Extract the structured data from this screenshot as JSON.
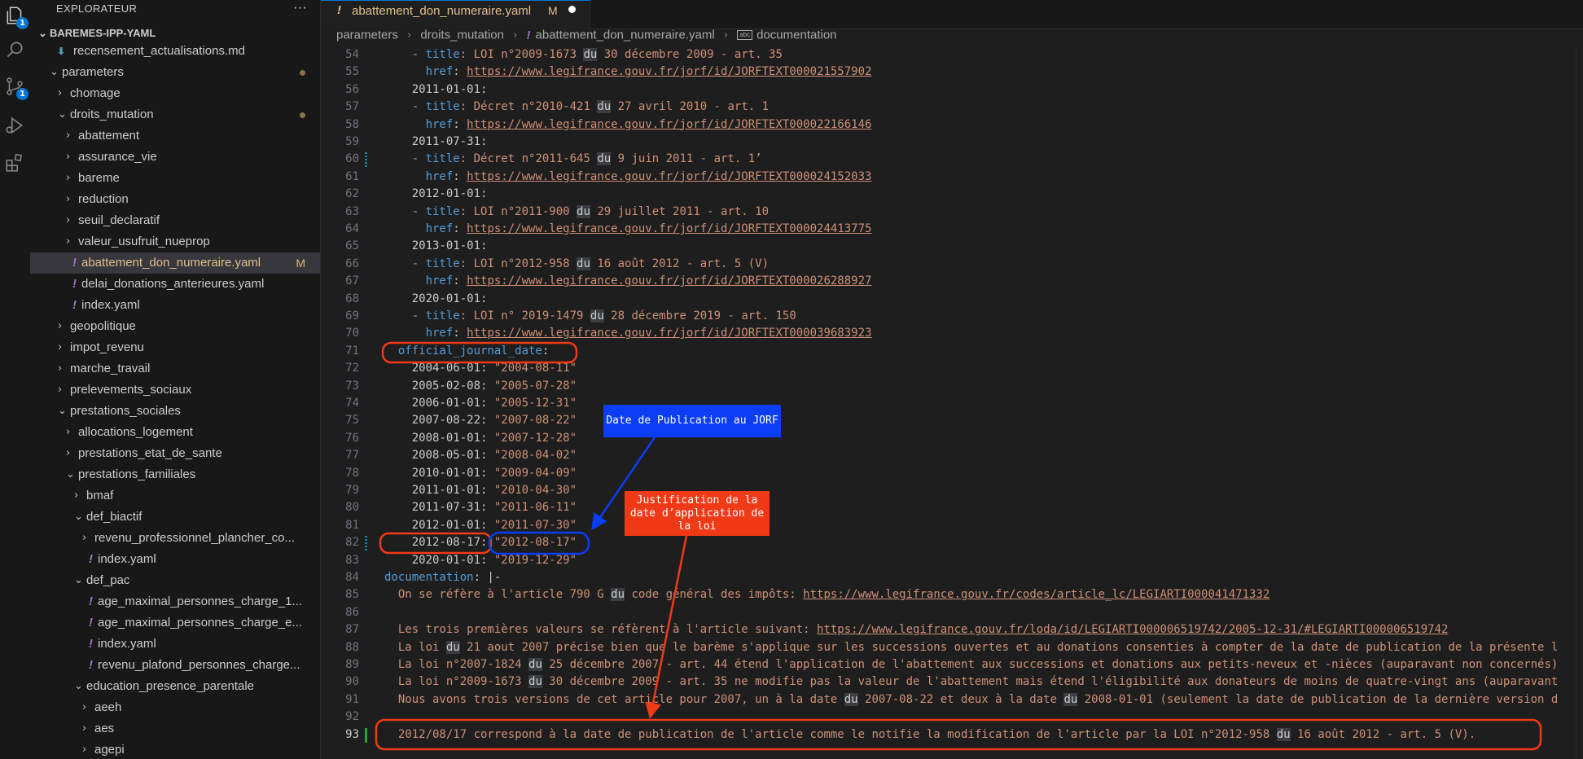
{
  "explorer": {
    "title": "EXPLORATEUR",
    "more": "···",
    "workspace": "BAREMES-IPP-YAML",
    "badges": {
      "explorer": "1",
      "scm": "1"
    },
    "tree": [
      {
        "label": "recensement_actualisations.md",
        "type": "md",
        "depth": 2
      },
      {
        "label": "parameters",
        "type": "folder",
        "depth": 1,
        "open": true,
        "dot": true
      },
      {
        "label": "chomage",
        "type": "folder",
        "depth": 2,
        "open": false
      },
      {
        "label": "droits_mutation",
        "type": "folder",
        "depth": 2,
        "open": true,
        "dot": true
      },
      {
        "label": "abattement",
        "type": "folder",
        "depth": 3,
        "open": false
      },
      {
        "label": "assurance_vie",
        "type": "folder",
        "depth": 3,
        "open": false
      },
      {
        "label": "bareme",
        "type": "folder",
        "depth": 3,
        "open": false
      },
      {
        "label": "reduction",
        "type": "folder",
        "depth": 3,
        "open": false
      },
      {
        "label": "seuil_declaratif",
        "type": "folder",
        "depth": 3,
        "open": false
      },
      {
        "label": "valeur_usufruit_nueprop",
        "type": "folder",
        "depth": 3,
        "open": false
      },
      {
        "label": "abattement_don_numeraire.yaml",
        "type": "yaml",
        "depth": 3,
        "selected": true,
        "modified": "M"
      },
      {
        "label": "delai_donations_anterieures.yaml",
        "type": "yaml",
        "depth": 3
      },
      {
        "label": "index.yaml",
        "type": "yaml",
        "depth": 3
      },
      {
        "label": "geopolitique",
        "type": "folder",
        "depth": 2,
        "open": false
      },
      {
        "label": "impot_revenu",
        "type": "folder",
        "depth": 2,
        "open": false
      },
      {
        "label": "marche_travail",
        "type": "folder",
        "depth": 2,
        "open": false
      },
      {
        "label": "prelevements_sociaux",
        "type": "folder",
        "depth": 2,
        "open": false
      },
      {
        "label": "prestations_sociales",
        "type": "folder",
        "depth": 2,
        "open": true
      },
      {
        "label": "allocations_logement",
        "type": "folder",
        "depth": 3,
        "open": false
      },
      {
        "label": "prestations_etat_de_sante",
        "type": "folder",
        "depth": 3,
        "open": false
      },
      {
        "label": "prestations_familiales",
        "type": "folder",
        "depth": 3,
        "open": true
      },
      {
        "label": "bmaf",
        "type": "folder",
        "depth": 4,
        "open": false
      },
      {
        "label": "def_biactif",
        "type": "folder",
        "depth": 4,
        "open": true
      },
      {
        "label": "revenu_professionnel_plancher_co...",
        "type": "folder",
        "depth": 5,
        "open": false
      },
      {
        "label": "index.yaml",
        "type": "yaml",
        "depth": 5
      },
      {
        "label": "def_pac",
        "type": "folder",
        "depth": 4,
        "open": true
      },
      {
        "label": "age_maximal_personnes_charge_1...",
        "type": "yaml",
        "depth": 5
      },
      {
        "label": "age_maximal_personnes_charge_e...",
        "type": "yaml",
        "depth": 5
      },
      {
        "label": "index.yaml",
        "type": "yaml",
        "depth": 5
      },
      {
        "label": "revenu_plafond_personnes_charge...",
        "type": "yaml",
        "depth": 5
      },
      {
        "label": "education_presence_parentale",
        "type": "folder",
        "depth": 4,
        "open": true
      },
      {
        "label": "aeeh",
        "type": "folder",
        "depth": 5,
        "open": false
      },
      {
        "label": "aes",
        "type": "folder",
        "depth": 5,
        "open": false
      },
      {
        "label": "agepi",
        "type": "folder",
        "depth": 5,
        "open": false
      }
    ]
  },
  "tab": {
    "fileicon": "!",
    "name": "abattement_don_numeraire.yaml",
    "status": "M"
  },
  "breadcrumb": {
    "parts": [
      "parameters",
      "droits_mutation",
      "abattement_don_numeraire.yaml",
      "documentation"
    ]
  },
  "editor": {
    "lines": [
      {
        "n": 54,
        "t": [
          [
            "    ",
            "p"
          ],
          [
            "- ",
            "dash"
          ],
          [
            "title",
            "k"
          ],
          [
            ": LOI n°2009-1673 ",
            "s"
          ],
          [
            "du",
            "hl"
          ],
          [
            " 30 décembre 2009 - art. 35",
            "s"
          ]
        ]
      },
      {
        "n": 55,
        "t": [
          [
            "      ",
            "p"
          ],
          [
            "href",
            "k"
          ],
          [
            ": ",
            "p"
          ],
          [
            "https://www.legifrance.gouv.fr/jorf/id/JORFTEXT000021557902",
            "u"
          ]
        ]
      },
      {
        "n": 56,
        "t": [
          [
            "    2011-01-01:",
            "p"
          ]
        ]
      },
      {
        "n": 57,
        "t": [
          [
            "    ",
            "p"
          ],
          [
            "- ",
            "dash"
          ],
          [
            "title",
            "k"
          ],
          [
            ": Décret n°2010-421 ",
            "s"
          ],
          [
            "du",
            "hl"
          ],
          [
            " 27 avril 2010 - art. 1",
            "s"
          ]
        ]
      },
      {
        "n": 58,
        "t": [
          [
            "      ",
            "p"
          ],
          [
            "href",
            "k"
          ],
          [
            ": ",
            "p"
          ],
          [
            "https://www.legifrance.gouv.fr/jorf/id/JORFTEXT000022166146",
            "u"
          ]
        ]
      },
      {
        "n": 59,
        "t": [
          [
            "    2011-07-31:",
            "p"
          ]
        ]
      },
      {
        "n": 60,
        "t": [
          [
            "    ",
            "p"
          ],
          [
            "- ",
            "dash"
          ],
          [
            "title",
            "k"
          ],
          [
            ": Décret n°2011-645 ",
            "s"
          ],
          [
            "du",
            "hl"
          ],
          [
            " 9 juin 2011 - art. 1’",
            "s"
          ]
        ]
      },
      {
        "n": 61,
        "t": [
          [
            "      ",
            "p"
          ],
          [
            "href",
            "k"
          ],
          [
            ": ",
            "p"
          ],
          [
            "https://www.legifrance.gouv.fr/jorf/id/JORFTEXT000024152033",
            "u"
          ]
        ]
      },
      {
        "n": 62,
        "t": [
          [
            "    2012-01-01:",
            "p"
          ]
        ]
      },
      {
        "n": 63,
        "t": [
          [
            "    ",
            "p"
          ],
          [
            "- ",
            "dash"
          ],
          [
            "title",
            "k"
          ],
          [
            ": LOI n°2011-900 ",
            "s"
          ],
          [
            "du",
            "hl"
          ],
          [
            " 29 juillet 2011 - art. 10",
            "s"
          ]
        ]
      },
      {
        "n": 64,
        "t": [
          [
            "      ",
            "p"
          ],
          [
            "href",
            "k"
          ],
          [
            ": ",
            "p"
          ],
          [
            "https://www.legifrance.gouv.fr/jorf/id/JORFTEXT000024413775",
            "u"
          ]
        ]
      },
      {
        "n": 65,
        "t": [
          [
            "    2013-01-01:",
            "p"
          ]
        ]
      },
      {
        "n": 66,
        "t": [
          [
            "    ",
            "p"
          ],
          [
            "- ",
            "dash"
          ],
          [
            "title",
            "k"
          ],
          [
            ": LOI n°2012-958 ",
            "s"
          ],
          [
            "du",
            "hl"
          ],
          [
            " 16 août 2012 - art. 5 (V)",
            "s"
          ]
        ]
      },
      {
        "n": 67,
        "t": [
          [
            "      ",
            "p"
          ],
          [
            "href",
            "k"
          ],
          [
            ": ",
            "p"
          ],
          [
            "https://www.legifrance.gouv.fr/jorf/id/JORFTEXT000026288927",
            "u"
          ]
        ]
      },
      {
        "n": 68,
        "t": [
          [
            "    2020-01-01:",
            "p"
          ]
        ]
      },
      {
        "n": 69,
        "t": [
          [
            "    ",
            "p"
          ],
          [
            "- ",
            "dash"
          ],
          [
            "title",
            "k"
          ],
          [
            ": LOI n° 2019-1479 ",
            "s"
          ],
          [
            "du",
            "hl"
          ],
          [
            " 28 décembre 2019 - art. 150",
            "s"
          ]
        ]
      },
      {
        "n": 70,
        "t": [
          [
            "      ",
            "p"
          ],
          [
            "href",
            "k"
          ],
          [
            ": ",
            "p"
          ],
          [
            "https://www.legifrance.gouv.fr/jorf/id/JORFTEXT000039683923",
            "u"
          ]
        ]
      },
      {
        "n": 71,
        "t": [
          [
            "  ",
            "p"
          ],
          [
            "official_journal_date",
            "k"
          ],
          [
            ":",
            "p"
          ]
        ]
      },
      {
        "n": 72,
        "t": [
          [
            "    2004-06-01: ",
            "p"
          ],
          [
            "\"2004-08-11\"",
            "s"
          ]
        ]
      },
      {
        "n": 73,
        "t": [
          [
            "    2005-02-08: ",
            "p"
          ],
          [
            "\"2005-07-28\"",
            "s"
          ]
        ]
      },
      {
        "n": 74,
        "t": [
          [
            "    2006-01-01: ",
            "p"
          ],
          [
            "\"2005-12-31\"",
            "s"
          ]
        ]
      },
      {
        "n": 75,
        "t": [
          [
            "    2007-08-22: ",
            "p"
          ],
          [
            "\"2007-08-22\"",
            "s"
          ]
        ]
      },
      {
        "n": 76,
        "t": [
          [
            "    2008-01-01: ",
            "p"
          ],
          [
            "\"2007-12-28\"",
            "s"
          ]
        ]
      },
      {
        "n": 77,
        "t": [
          [
            "    2008-05-01: ",
            "p"
          ],
          [
            "\"2008-04-02\"",
            "s"
          ]
        ]
      },
      {
        "n": 78,
        "t": [
          [
            "    2010-01-01: ",
            "p"
          ],
          [
            "\"2009-04-09\"",
            "s"
          ]
        ]
      },
      {
        "n": 79,
        "t": [
          [
            "    2011-01-01: ",
            "p"
          ],
          [
            "\"2010-04-30\"",
            "s"
          ]
        ]
      },
      {
        "n": 80,
        "t": [
          [
            "    2011-07-31: ",
            "p"
          ],
          [
            "\"2011-06-11\"",
            "s"
          ]
        ]
      },
      {
        "n": 81,
        "t": [
          [
            "    2012-01-01: ",
            "p"
          ],
          [
            "\"2011-07-30\"",
            "s"
          ]
        ]
      },
      {
        "n": 82,
        "t": [
          [
            "    2012-08-17: ",
            "p"
          ],
          [
            "\"2012-08-17\"",
            "s"
          ]
        ]
      },
      {
        "n": 83,
        "t": [
          [
            "    2020-01-01: ",
            "p"
          ],
          [
            "\"2019-12-29\"",
            "s"
          ]
        ]
      },
      {
        "n": 84,
        "t": [
          [
            "documentation",
            "k"
          ],
          [
            ": |-",
            "p"
          ]
        ]
      },
      {
        "n": 85,
        "t": [
          [
            "  On se réfère à l'article 790 G ",
            "s"
          ],
          [
            "du",
            "hl"
          ],
          [
            " code général des impôts: ",
            "s"
          ],
          [
            "https://www.legifrance.gouv.fr/codes/article_lc/LEGIARTI000041471332",
            "u"
          ]
        ]
      },
      {
        "n": 86,
        "t": [
          [
            "",
            "p"
          ]
        ]
      },
      {
        "n": 87,
        "t": [
          [
            "  Les trois premières valeurs se réfèrent à l'article suivant: ",
            "s"
          ],
          [
            "https://www.legifrance.gouv.fr/loda/id/LEGIARTI000006519742/2005-12-31/#LEGIARTI000006519742",
            "u"
          ]
        ]
      },
      {
        "n": 88,
        "t": [
          [
            "  La loi ",
            "s"
          ],
          [
            "du",
            "hl"
          ],
          [
            " 21 aout 2007 précise bien que le barème s'applique sur les successions ouvertes et au donations consenties à compter de la date de publication de la présente l",
            "s"
          ]
        ]
      },
      {
        "n": 89,
        "t": [
          [
            "  La loi n°2007-1824 ",
            "s"
          ],
          [
            "du",
            "hl"
          ],
          [
            " 25 décembre 2007 - art. 44 étend l'application de l'abattement aux successions et donations aux petits-neveux et -nièces (auparavant non concernés)",
            "s"
          ]
        ]
      },
      {
        "n": 90,
        "t": [
          [
            "  La loi n°2009-1673 ",
            "s"
          ],
          [
            "du",
            "hl"
          ],
          [
            " 30 décembre 2009 - art. 35 ne modifie pas la valeur de l'abattement mais étend l'éligibilité aux donateurs de moins de quatre-vingt ans (auparavant",
            "s"
          ]
        ]
      },
      {
        "n": 91,
        "t": [
          [
            "  Nous avons trois versions de cet article pour 2007, un à la date ",
            "s"
          ],
          [
            "du",
            "hl"
          ],
          [
            " 2007-08-22 et deux à la date ",
            "s"
          ],
          [
            "du",
            "hl"
          ],
          [
            " 2008-01-01 (seulement la date de publication de la dernière version d",
            "s"
          ]
        ]
      },
      {
        "n": 92,
        "t": [
          [
            "",
            "p"
          ]
        ]
      },
      {
        "n": 93,
        "t": [
          [
            "  2012/08/17 correspond à la date de publication de l'article comme le notifie la modification de l'article par la LOI n°2012-958 ",
            "s"
          ],
          [
            "du",
            "hl"
          ],
          [
            " 16 août 2012 - art. 5 (V).",
            "s"
          ]
        ]
      }
    ]
  },
  "annotations": {
    "blue_label": "Date de Publication au JORF",
    "red_label": "Justification de la date d’application de la loi",
    "blue_color": "#0b3df5",
    "red_color": "#f03a17"
  },
  "colors": {
    "accent": "#0078d4",
    "keyword": "#569cd6",
    "string": "#ce9178",
    "modified": "#e2c08d",
    "yaml_icon": "#a074c4"
  }
}
